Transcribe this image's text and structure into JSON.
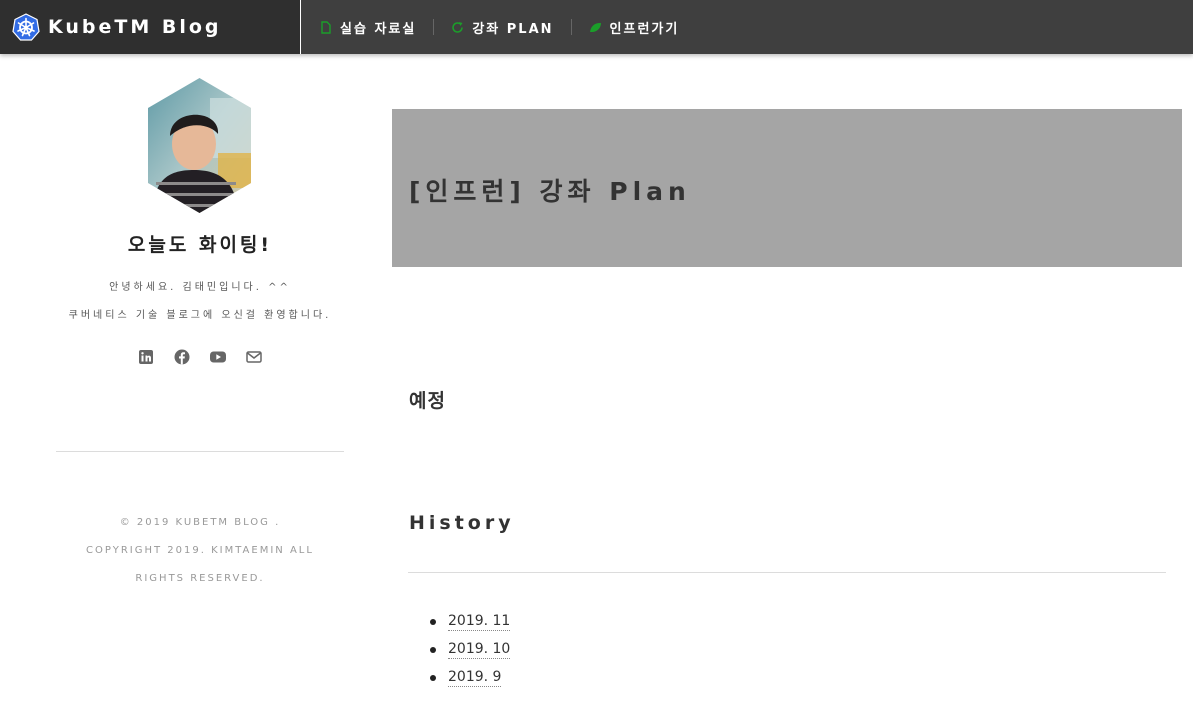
{
  "header": {
    "brand_title": "KubeTM Blog",
    "nav": [
      {
        "label": "실습 자료실",
        "icon": "file-icon"
      },
      {
        "label": "강좌 PLAN",
        "icon": "refresh-icon"
      },
      {
        "label": "인프런가기",
        "icon": "leaf-icon"
      }
    ],
    "accent_color": "#1b9e2a"
  },
  "sidebar": {
    "tagline": "오늘도 화이팅!",
    "bio": [
      "안녕하세요. 김태민입니다. ^^",
      "쿠버네티스 기술 블로그에 오신걸 환영합니다."
    ],
    "socials": [
      "linkedin-icon",
      "facebook-icon",
      "youtube-icon",
      "email-icon"
    ],
    "footer": [
      "© 2019 KUBETM BLOG .",
      "COPYRIGHT 2019. KIMTAEMIN ALL",
      "RIGHTS RESERVED."
    ]
  },
  "main": {
    "hero_title": "[인프런] 강좌 Plan",
    "sections": [
      {
        "title": "예정"
      },
      {
        "title": "History"
      }
    ],
    "history_items": [
      "2019. 11",
      "2019. 10",
      "2019. 9"
    ]
  }
}
